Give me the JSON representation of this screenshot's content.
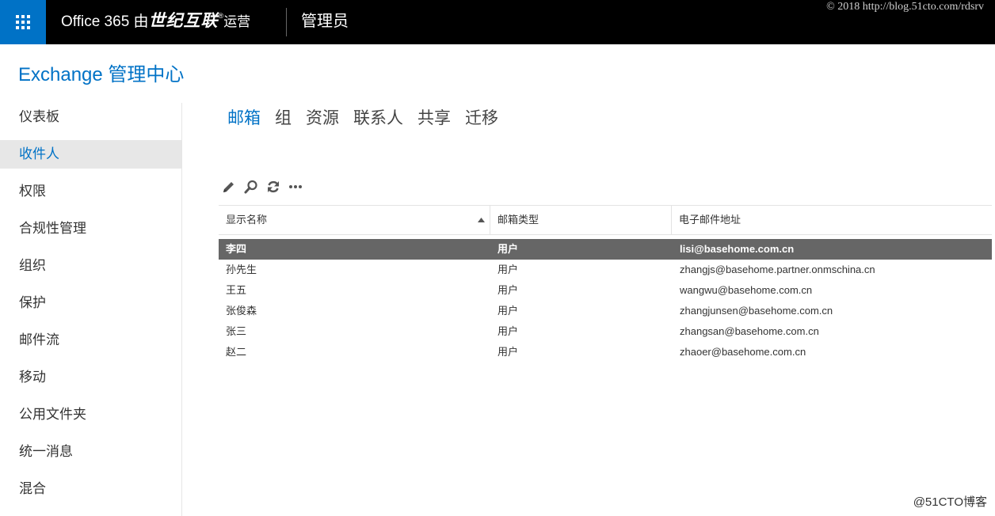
{
  "topbar": {
    "brand_prefix": "Office 365 由",
    "brand_partner": "世纪互联",
    "brand_reg": "®",
    "brand_suffix": "运营",
    "admin_label": "管理员",
    "watermark": "© 2018 http://blog.51cto.com/rdsrv"
  },
  "header": {
    "title": "Exchange 管理中心"
  },
  "sidebar": {
    "items": [
      {
        "label": "仪表板"
      },
      {
        "label": "收件人"
      },
      {
        "label": "权限"
      },
      {
        "label": "合规性管理"
      },
      {
        "label": "组织"
      },
      {
        "label": "保护"
      },
      {
        "label": "邮件流"
      },
      {
        "label": "移动"
      },
      {
        "label": "公用文件夹"
      },
      {
        "label": "统一消息"
      },
      {
        "label": "混合"
      }
    ],
    "active_index": 1
  },
  "tabs": [
    {
      "label": "邮箱"
    },
    {
      "label": "组"
    },
    {
      "label": "资源"
    },
    {
      "label": "联系人"
    },
    {
      "label": "共享"
    },
    {
      "label": "迁移"
    }
  ],
  "toolbar": {
    "icons": [
      "edit-icon",
      "search-icon",
      "refresh-icon",
      "more-icon"
    ]
  },
  "table": {
    "columns": [
      "显示名称",
      "邮箱类型",
      "电子邮件地址"
    ],
    "rows": [
      {
        "name": "李四",
        "type": "用户",
        "email": "lisi@basehome.com.cn",
        "selected": true
      },
      {
        "name": "孙先生",
        "type": "用户",
        "email": "zhangjs@basehome.partner.onmschina.cn"
      },
      {
        "name": "王五",
        "type": "用户",
        "email": "wangwu@basehome.com.cn"
      },
      {
        "name": "张俊森",
        "type": "用户",
        "email": "zhangjunsen@basehome.com.cn"
      },
      {
        "name": "张三",
        "type": "用户",
        "email": "zhangsan@basehome.com.cn"
      },
      {
        "name": "赵二",
        "type": "用户",
        "email": "zhaoer@basehome.com.cn"
      }
    ]
  },
  "footer": {
    "watermark": "@51CTO博客"
  },
  "colors": {
    "accent": "#0072c6",
    "topbar": "#000000",
    "selected_row": "#666666",
    "active_nav": "#e7e7e7"
  }
}
